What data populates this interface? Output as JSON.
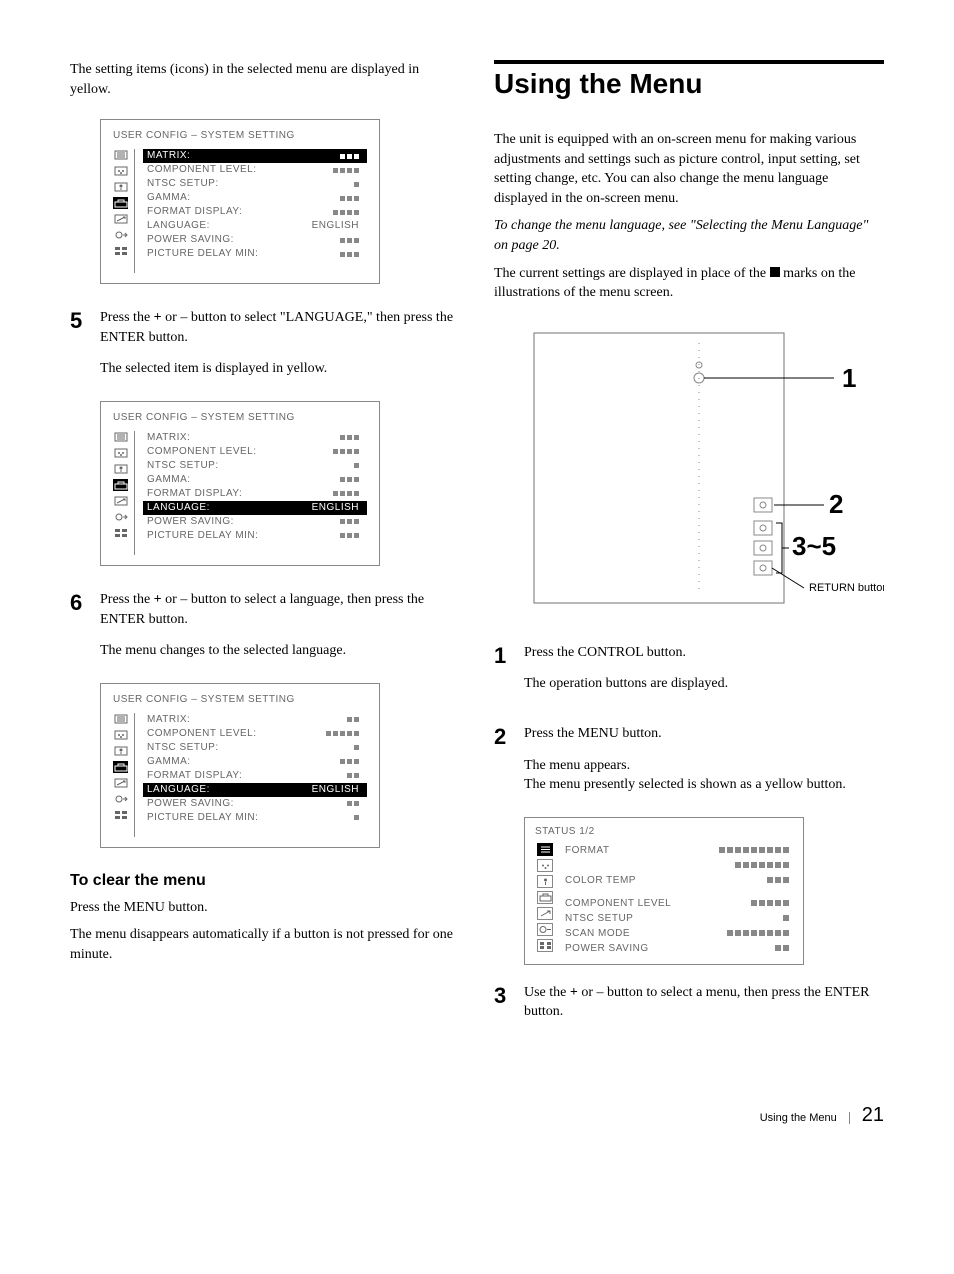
{
  "left": {
    "intro": "The setting items (icons) in the selected menu are displayed in yellow.",
    "panel1": {
      "title": "USER CONFIG – SYSTEM SETTING",
      "highlightIndex": 0,
      "rows": [
        {
          "label": "MATRIX:",
          "squares": 3
        },
        {
          "label": "COMPONENT LEVEL:",
          "squares": 4
        },
        {
          "label": "NTSC SETUP:",
          "squares": 1
        },
        {
          "label": "GAMMA:",
          "squares": 3
        },
        {
          "label": "FORMAT DISPLAY:",
          "squares": 4
        },
        {
          "label": "LANGUAGE:",
          "value": "ENGLISH"
        },
        {
          "label": "POWER SAVING:",
          "squares": 3
        },
        {
          "label": "PICTURE DELAY MIN:",
          "squares": 3
        }
      ]
    },
    "step5": {
      "num": "5",
      "p1_a": "Press the ",
      "p1_plus": "+",
      "p1_b": " or – button to select \"LANGUAGE,\" then press the ENTER button.",
      "p2": "The selected item is displayed in yellow."
    },
    "panel2": {
      "title": "USER CONFIG – SYSTEM SETTING",
      "highlightIndex": 5,
      "rows": [
        {
          "label": "MATRIX:",
          "squares": 3
        },
        {
          "label": "COMPONENT LEVEL:",
          "squares": 4
        },
        {
          "label": "NTSC SETUP:",
          "squares": 1
        },
        {
          "label": "GAMMA:",
          "squares": 3
        },
        {
          "label": "FORMAT DISPLAY:",
          "squares": 4
        },
        {
          "label": "LANGUAGE:",
          "value": "ENGLISH"
        },
        {
          "label": "POWER SAVING:",
          "squares": 3
        },
        {
          "label": "PICTURE DELAY MIN:",
          "squares": 3
        }
      ]
    },
    "step6": {
      "num": "6",
      "p1_a": "Press the ",
      "p1_plus": "+",
      "p1_b": " or – button to select a language, then press the ENTER button.",
      "p2": "The menu changes to the selected language."
    },
    "panel3": {
      "title": "USER CONFIG – SYSTEM SETTING",
      "highlightIndex": 5,
      "rightAlign": true,
      "rows": [
        {
          "label": "MATRIX:",
          "squares": 2
        },
        {
          "label": "COMPONENT LEVEL:",
          "squares": 5
        },
        {
          "label": "NTSC SETUP:",
          "squares": 1
        },
        {
          "label": "GAMMA:",
          "squares": 3
        },
        {
          "label": "FORMAT DISPLAY:",
          "squares": 2
        },
        {
          "label": "LANGUAGE:",
          "value": "ENGLISH"
        },
        {
          "label": "POWER SAVING:",
          "squares": 2
        },
        {
          "label": "PICTURE DELAY MIN:",
          "squares": 1
        }
      ]
    },
    "clear": {
      "heading": "To clear the menu",
      "p1": "Press the MENU button.",
      "p2": "The menu disappears automatically if a button is not pressed for one minute."
    }
  },
  "right": {
    "heading": "Using the Menu",
    "intro": "The unit is equipped with an on-screen menu for making various adjustments and settings such as picture control, input setting, set setting change, etc.  You can also change the menu language displayed in the on-screen menu.",
    "italic": "To change the menu language, see \"Selecting the Menu Language\" on page 20.",
    "mark_a": "The current settings are displayed in place of the ",
    "mark_b": " marks on the illustrations of the menu screen.",
    "diagram": {
      "n1": "1",
      "n2": "2",
      "n3": "3~5",
      "caption": "RETURN button"
    },
    "step1": {
      "num": "1",
      "p1": "Press the CONTROL button.",
      "p2": "The operation buttons are displayed."
    },
    "step2": {
      "num": "2",
      "p1": "Press the MENU button.",
      "p2": "The menu appears.",
      "p3": "The menu presently selected is shown as a yellow button."
    },
    "status": {
      "title": "STATUS 1/2",
      "rows": [
        {
          "label": "FORMAT",
          "squares": 9
        },
        {
          "label": "",
          "squares": 7
        },
        {
          "label": "COLOR TEMP",
          "squares": 3
        },
        null,
        {
          "label": "COMPONENT LEVEL",
          "squares": 5
        },
        {
          "label": "NTSC SETUP",
          "squares": 1
        },
        {
          "label": "SCAN MODE",
          "squares": 8
        },
        {
          "label": "POWER SAVING",
          "squares": 2
        }
      ]
    },
    "step3": {
      "num": "3",
      "p1_a": "Use the ",
      "p1_plus": "+",
      "p1_b": " or – button to select a menu, then press the ENTER button."
    }
  },
  "footer": {
    "title": "Using the Menu",
    "page": "21"
  }
}
